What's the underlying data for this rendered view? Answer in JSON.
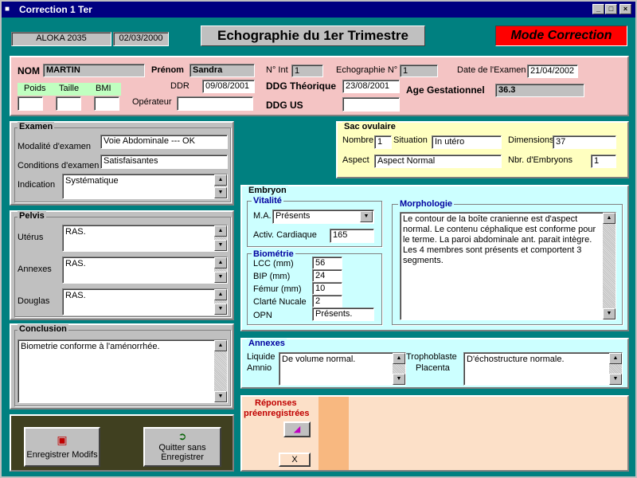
{
  "window": {
    "title": "Correction 1 Ter"
  },
  "header": {
    "device": "ALOKA 2035",
    "date": "02/03/2000",
    "page_title": "Echographie du 1er Trimestre",
    "mode": "Mode Correction"
  },
  "colors": {
    "teal": "#008080",
    "pink": "#f4c4c4",
    "yellow": "#ffffc0",
    "cyan": "#ccffff",
    "peach": "#fce0c8",
    "mode_red": "#ff0000",
    "green": "#c0ffc0",
    "olive": "#404020"
  },
  "patient": {
    "nom_label": "NOM",
    "nom_value": "MARTIN",
    "prenom_label": "Prénom",
    "prenom_value": "Sandra",
    "nint_label": "N° Int",
    "nint_value": "1",
    "echo_label": "Echographie N°",
    "echo_value": "1",
    "date_exam_label": "Date de l'Examen",
    "date_exam_value": "21/04/2002",
    "poids_label": "Poids",
    "taille_label": "Taille",
    "bmi_label": "BMI",
    "poids_value": "",
    "taille_value": "",
    "bmi_value": "",
    "ddr_label": "DDR",
    "ddr_value": "09/08/2001",
    "ddg_theo_label": "DDG Théorique",
    "ddg_theo_value": "23/08/2001",
    "age_gest_label": "Age Gestationnel",
    "age_gest_value": "36.3",
    "operateur_label": "Opérateur",
    "operateur_value": "",
    "ddg_us_label": "DDG US",
    "ddg_us_value": ""
  },
  "examen": {
    "title": "Examen",
    "modalite_label": "Modalité d'examen",
    "modalite_value": "Voie Abdominale --- OK",
    "conditions_label": "Conditions d'examen",
    "conditions_value": "Satisfaisantes",
    "indication_label": "Indication",
    "indication_value": "Systématique"
  },
  "pelvis": {
    "title": "Pelvis",
    "uterus_label": "Utérus",
    "uterus_value": "RAS.",
    "annexes_label": "Annexes",
    "annexes_value": "RAS.",
    "douglas_label": "Douglas",
    "douglas_value": "RAS."
  },
  "conclusion": {
    "title": "Conclusion",
    "value": "Biometrie conforme à l'aménorrhée."
  },
  "sac": {
    "title": "Sac ovulaire",
    "nombre_label": "Nombre",
    "nombre_value": "1",
    "situation_label": "Situation",
    "situation_value": "In utéro",
    "dimensions_label": "Dimensions",
    "dimensions_value": "37",
    "aspect_label": "Aspect",
    "aspect_value": "Aspect Normal",
    "nbr_embryons_label": "Nbr. d'Embryons",
    "nbr_embryons_value": "1"
  },
  "embryon": {
    "title": "Embryon",
    "vitalite_title": "Vitalité",
    "ma_label": "M.A.",
    "ma_value": "Présents",
    "activ_label": "Activ. Cardiaque",
    "activ_value": "165",
    "biometrie_title": "Biométrie",
    "lcc_label": "LCC (mm)",
    "lcc_value": "56",
    "bip_label": "BIP (mm)",
    "bip_value": "24",
    "femur_label": "Fémur (mm)",
    "femur_value": "10",
    "clarte_label": "Clarté Nucale",
    "clarte_value": "2",
    "opn_label": "OPN",
    "opn_value": "Présents.",
    "morphologie_title": "Morphologie",
    "morphologie_value": "Le contour de la boîte cranienne est d'aspect normal. Le contenu céphalique est conforme pour le terme. La paroi abdominale ant. parait intègre. Les 4 membres sont présents et comportent 3 segments."
  },
  "annexes": {
    "title": "Annexes",
    "liquide_label": "Liquide",
    "amnio_label": "Amnio",
    "liquide_value": "De volume normal.",
    "tropho_label": "Trophoblaste",
    "placenta_label": "Placenta",
    "tropho_value": "D'échostructure normale."
  },
  "reponses": {
    "line1": "Réponses",
    "line2": "préenregistrées",
    "close_label": "X"
  },
  "actions": {
    "save_label": "Enregistrer Modifs",
    "quit_label_1": "Quitter sans",
    "quit_label_2": "Enregistrer"
  }
}
